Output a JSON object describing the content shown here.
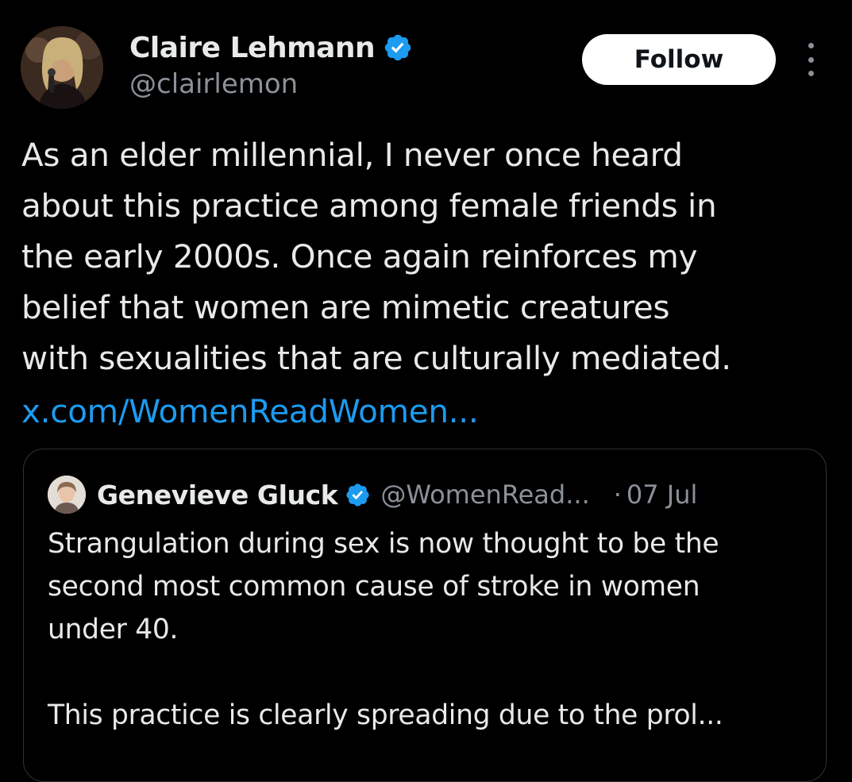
{
  "tweet": {
    "author": {
      "display_name": "Claire Lehmann",
      "handle": "@clairlemon",
      "verified": true,
      "avatar_icon": "profile-photo"
    },
    "follow_label": "Follow",
    "more_icon": "vertical-ellipsis-icon",
    "text": "As an elder millennial, I never once heard\nabout this practice among female friends in\nthe early 2000s. Once again reinforces my\nbelief that women are mimetic creatures\nwith sexualities that are culturally mediated.",
    "link": "x.com/WomenReadWomen..."
  },
  "quoted_tweet": {
    "author": {
      "display_name": "Genevieve Gluck",
      "handle": "@WomenRead...",
      "verified": true
    },
    "separator": "·",
    "date": "07 Jul",
    "text": "Strangulation during sex is now thought to be the\nsecond most common cause of stroke in women\nunder 40.\n\nThis practice is clearly spreading due to the prol..."
  },
  "colors": {
    "background": "#000000",
    "text_primary": "#e7e9ea",
    "text_secondary": "#8b9198",
    "link": "#1d9bf0",
    "verified_badge": "#1d9bf0",
    "follow_button_bg": "#ffffff",
    "card_border": "#2f3336"
  }
}
